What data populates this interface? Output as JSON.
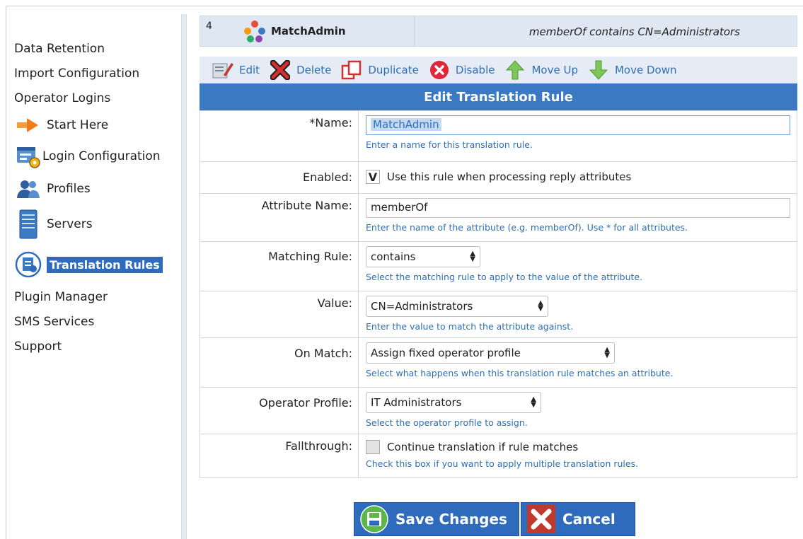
{
  "sidebar": {
    "items_top": [
      "Data Retention",
      "Import Configuration",
      "Operator Logins"
    ],
    "start_here": "Start Here",
    "login_configuration": "Login Configuration",
    "profiles": "Profiles",
    "servers": "Servers",
    "translation_rules": "Translation Rules",
    "items_bottom": [
      "Plugin Manager",
      "SMS Services",
      "Support"
    ]
  },
  "rule": {
    "number": "4",
    "name": "MatchAdmin",
    "condition": "memberOf contains CN=Administrators"
  },
  "toolbar": {
    "edit": "Edit",
    "delete": "Delete",
    "duplicate": "Duplicate",
    "disable": "Disable",
    "move_up": "Move Up",
    "move_down": "Move Down"
  },
  "form": {
    "title": "Edit Translation Rule",
    "name": {
      "label": "*Name:",
      "value": "MatchAdmin",
      "hint": "Enter a name for this translation rule."
    },
    "enabled": {
      "label": "Enabled:",
      "text": "Use this rule when processing reply attributes",
      "checked_mark": "V"
    },
    "attribute_name": {
      "label": "Attribute Name:",
      "value": "memberOf",
      "hint": "Enter the name of the attribute (e.g. memberOf). Use * for all attributes."
    },
    "matching_rule": {
      "label": "Matching Rule:",
      "value": "contains",
      "hint": "Select the matching rule to apply to the value of the attribute."
    },
    "value": {
      "label": "Value:",
      "value": "CN=Administrators",
      "hint": "Enter the value to match the attribute against."
    },
    "on_match": {
      "label": "On Match:",
      "value": "Assign fixed operator profile",
      "hint": "Select what happens when this translation rule matches an attribute."
    },
    "operator_profile": {
      "label": "Operator Profile:",
      "value": "IT Administrators",
      "hint": "Select the operator profile to assign."
    },
    "fallthrough": {
      "label": "Fallthrough:",
      "text": "Continue translation if rule matches",
      "hint": "Check this box if you want to apply multiple translation rules."
    }
  },
  "buttons": {
    "save": "Save Changes",
    "cancel": "Cancel"
  },
  "colors": {
    "accent": "#3b79c3",
    "link": "#2d6fb7",
    "header_bg": "#dfe7f3"
  }
}
